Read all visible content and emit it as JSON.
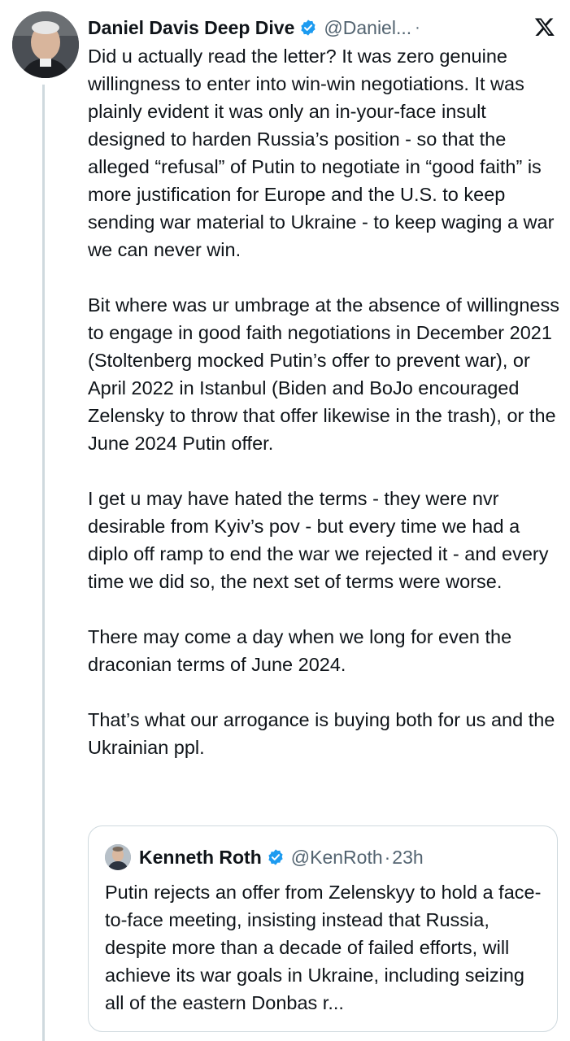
{
  "tweet": {
    "author_name": "Daniel Davis Deep Dive",
    "handle": "@Daniel...",
    "separator": "·",
    "paragraphs": [
      "Did u actually read the letter? It was zero genuine willingness to enter into win-win negotiations. It was plainly evident it was only an in-your-face insult designed to harden Russia’s position - so that the alleged “refusal” of Putin to negotiate in “good faith” is more justification for Europe and the U.S. to keep sending war material to Ukraine - to keep waging a war we can never win.",
      "Bit where was ur umbrage at the absence of willingness to engage in good faith negotiations in December 2021 (Stoltenberg mocked Putin’s offer to prevent war), or April 2022 in Istanbul (Biden and BoJo encouraged Zelensky to throw that offer likewise in the trash), or the June 2024 Putin offer.",
      "I get u may have hated the terms - they were nvr desirable from Kyiv’s pov - but every time we had a diplo off ramp to end the war we rejected it - and every time we did so, the next set of terms were worse.",
      "There may come a day when we long for even the draconian terms of June 2024.",
      "That’s what our arrogance is buying both for us and the Ukrainian ppl."
    ]
  },
  "quote": {
    "author_name": "Kenneth Roth",
    "handle": "@KenRoth",
    "separator": "·",
    "time": "23h",
    "text": "Putin rejects an offer from Zelenskyy to hold a face-to-face meeting, insisting instead that Russia, despite more than a decade of failed efforts, will achieve its war goals in Ukraine, including seizing all of the eastern Donbas r..."
  },
  "icons": {
    "verified": "verified-badge-icon",
    "brand": "x-logo-icon"
  },
  "colors": {
    "verified": "#1d9bf0",
    "text": "#0f1419",
    "secondary": "#536471",
    "border": "#cfd9de"
  }
}
